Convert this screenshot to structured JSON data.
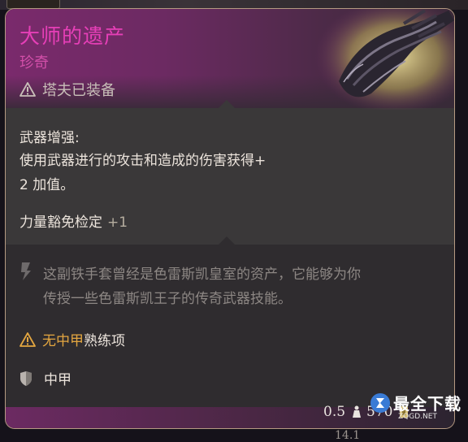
{
  "item": {
    "name": "大师的遗产",
    "rarity": "珍奇",
    "equipped_by": "塔夫已装备"
  },
  "weapon_enhancement": {
    "title": "武器增强:",
    "line1": "使用武器进行的攻击和造成的伤害获得+",
    "line2": "2 加值。",
    "save_label": "力量豁免检定",
    "save_bonus": "+1"
  },
  "lore": {
    "line1": "这副铁手套曾经是色雷斯凯皇室的资产，它能够为你",
    "line2": "传授一些色雷斯凯王子的传奇武器技能。"
  },
  "proficiency": {
    "warning": "无中甲",
    "rest": "熟练项"
  },
  "armor": {
    "type": "中甲"
  },
  "stats": {
    "weight": "0.5",
    "value": "570",
    "bottom_value": "14.1"
  },
  "watermark": {
    "text": "最全下载",
    "url": "ZQGD.NET"
  },
  "icons": {
    "equipped": "warning-triangle-icon",
    "lore": "lore-scroll-icon",
    "proficiency": "warning-triangle-icon",
    "armor": "armor-shield-icon",
    "weight": "weight-icon",
    "value": "coin-icon"
  },
  "colors": {
    "rarity_accent": "#e63fb7",
    "warning": "#e3a640",
    "text": "#ece4dc",
    "muted": "#8d8784"
  }
}
